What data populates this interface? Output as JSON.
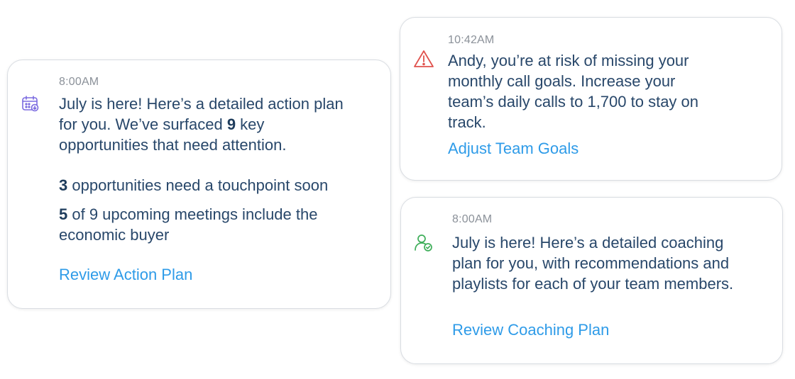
{
  "colors": {
    "text": "#28476a",
    "link": "#2e9be8",
    "timestamp": "#8b9199",
    "calendar_icon": "#7b6be0",
    "warning_icon": "#e0524d",
    "coach_icon": "#3fae5a"
  },
  "cards": [
    {
      "time": "8:00AM",
      "icon": "calendar-icon",
      "intro": {
        "line1": "July is here! Here’s a detailed action plan",
        "line2_pre": "for you. We’ve surfaced ",
        "line2_bold": "9",
        "line2_post": " key",
        "line3": "opportunities that need attention."
      },
      "stat1": {
        "bold": "3",
        "text": " opportunities need a touchpoint soon"
      },
      "stat2": {
        "bold": "5",
        "text_line1": " of 9 upcoming meetings include the",
        "text_line2": "economic buyer"
      },
      "link": "Review Action Plan"
    },
    {
      "time": "10:42AM",
      "icon": "warning-icon",
      "lines": [
        "Andy, you’re at risk of missing your",
        "monthly call goals. Increase your",
        "team’s daily calls to 1,700 to stay on",
        "track."
      ],
      "link": "Adjust Team Goals"
    },
    {
      "time": "8:00AM",
      "icon": "user-check-icon",
      "lines": [
        "July is here! Here’s a detailed coaching",
        "plan for you, with recommendations and",
        "playlists for each of your team members."
      ],
      "link": "Review Coaching Plan"
    }
  ]
}
